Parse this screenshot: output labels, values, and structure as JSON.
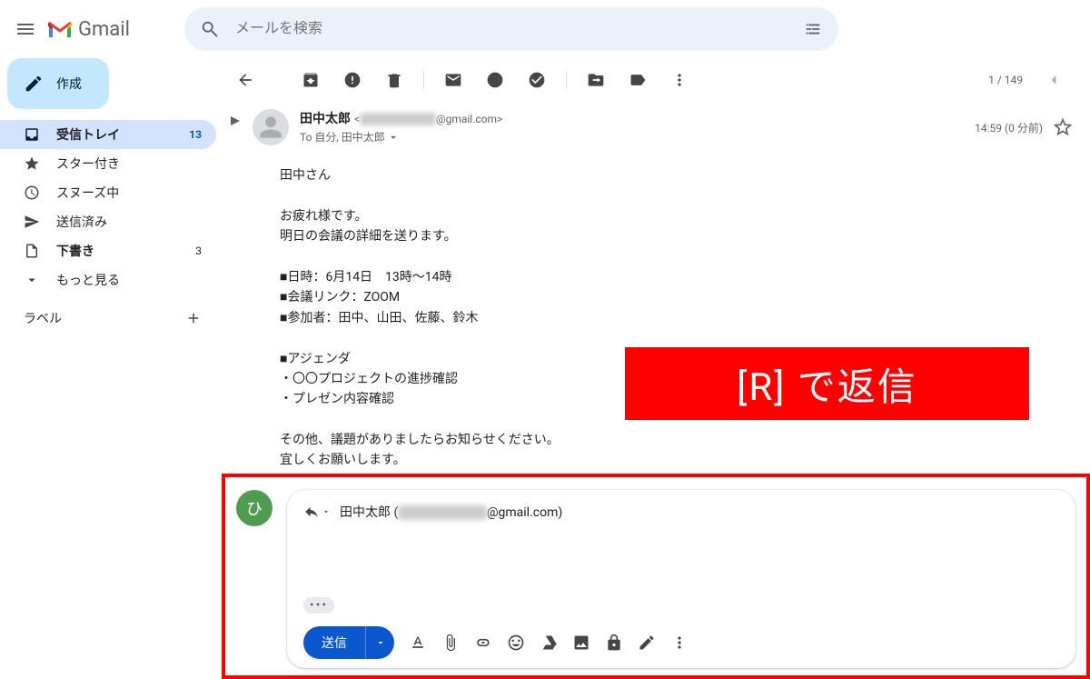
{
  "header": {
    "logo_text": "Gmail",
    "search_placeholder": "メールを検索"
  },
  "compose_label": "作成",
  "nav": {
    "inbox": {
      "label": "受信トレイ",
      "count": "13"
    },
    "starred": {
      "label": "スター付き"
    },
    "snoozed": {
      "label": "スヌーズ中"
    },
    "sent": {
      "label": "送信済み"
    },
    "drafts": {
      "label": "下書き",
      "count": "3"
    },
    "more": {
      "label": "もっと見る"
    }
  },
  "labels_header": "ラベル",
  "toolbar": {
    "counter": "1 / 149"
  },
  "message": {
    "sender_name": "田中太郎",
    "sender_email_prefix": "<",
    "sender_email_hidden": "xxx.xxxxx.xxxxx",
    "sender_email_suffix": "@gmail.com>",
    "to_line": "To 自分, 田中太郎",
    "time": "14:59 (0 分前)",
    "body": "田中さん\n\nお疲れ様です。\n明日の会議の詳細を送ります。\n\n■日時：6月14日　13時～14時\n■会議リンク：ZOOM\n■参加者：田中、山田、佐藤、鈴木\n\n■アジェンダ\n・〇〇プロジェクトの進捗確認\n・プレゼン内容確認\n\nその他、議題がありましたらお知らせください。\n宜しくお願いします。"
  },
  "overlay": "[R] で返信",
  "reply": {
    "avatar_char": "ひ",
    "to_name": "田中太郎 (",
    "to_hidden": "xxx.xxxxx.xxxxx",
    "to_suffix": "@gmail.com)",
    "send_label": "送信"
  }
}
